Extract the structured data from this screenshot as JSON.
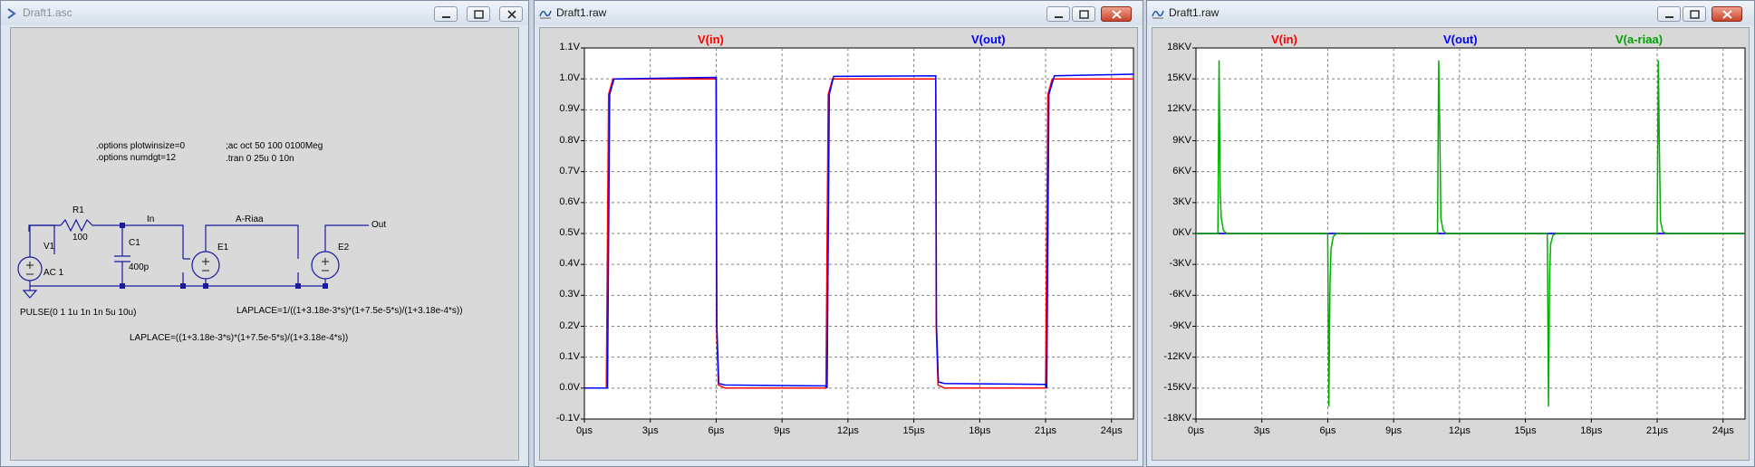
{
  "windows": {
    "schematic": {
      "title": "Draft1.asc"
    },
    "plot1": {
      "title": "Draft1.raw"
    },
    "plot2": {
      "title": "Draft1.raw"
    }
  },
  "schematic": {
    "directives": {
      "opt1": ".options plotwinsize=0",
      "opt2": ".options numdgt=12",
      "ac": ";ac oct 50 100 0100Meg",
      "tran": ".tran 0 25u 0 10n"
    },
    "labels": {
      "r1": "R1",
      "r1_val": "100",
      "c1": "C1",
      "c1_val": "400p",
      "v1": "V1",
      "v1_ac": "AC 1",
      "e1": "E1",
      "e2": "E2",
      "net_in": "In",
      "net_ariaa": "A-Riaa",
      "net_out": "Out",
      "pulse": "PULSE(0 1 1u 1n 1n 5u 10u)",
      "laplace_e2": "LAPLACE=1/((1+3.18e-3*s)*(1+7.5e-5*s)/(1+3.18e-4*s))",
      "laplace_e1": "LAPLACE=((1+3.18e-3*s)*(1+7.5e-5*s)/(1+3.18e-4*s))"
    }
  },
  "plot1": {
    "traces": [
      {
        "name": "V(in)",
        "color": "#ff0000"
      },
      {
        "name": "V(out)",
        "color": "#0000ff"
      }
    ],
    "y_ticks": [
      "1.1V",
      "1.0V",
      "0.9V",
      "0.8V",
      "0.7V",
      "0.6V",
      "0.5V",
      "0.4V",
      "0.3V",
      "0.2V",
      "0.1V",
      "0.0V",
      "-0.1V"
    ],
    "x_ticks": [
      "0µs",
      "3µs",
      "6µs",
      "9µs",
      "12µs",
      "15µs",
      "18µs",
      "21µs",
      "24µs"
    ]
  },
  "plot2": {
    "traces": [
      {
        "name": "V(in)",
        "color": "#ff0000"
      },
      {
        "name": "V(out)",
        "color": "#0000ff"
      },
      {
        "name": "V(a-riaa)",
        "color": "#00b000"
      }
    ],
    "y_ticks": [
      "18KV",
      "15KV",
      "12KV",
      "9KV",
      "6KV",
      "3KV",
      "0KV",
      "-3KV",
      "-6KV",
      "-9KV",
      "-12KV",
      "-15KV",
      "-18KV"
    ],
    "x_ticks": [
      "0µs",
      "3µs",
      "6µs",
      "9µs",
      "12µs",
      "15µs",
      "18µs",
      "21µs",
      "24µs"
    ]
  },
  "chart_data": [
    {
      "type": "line",
      "xlabel": "",
      "ylabel": "",
      "xlim": [
        0,
        25
      ],
      "ylim": [
        -0.1,
        1.1
      ],
      "grid": true,
      "series": [
        {
          "name": "V(in)",
          "x": [
            0,
            1,
            1.1,
            1.3,
            6,
            6.02,
            6.1,
            6.4,
            11,
            11.1,
            11.3,
            16,
            16.02,
            16.1,
            16.4,
            21,
            21.1,
            21.3,
            25
          ],
          "y": [
            0,
            0,
            0.95,
            1.0,
            1.0,
            0.2,
            0.01,
            0.0,
            0.0,
            0.95,
            1.0,
            1.0,
            0.2,
            0.01,
            0.0,
            0.0,
            0.95,
            1.0,
            1.0
          ]
        },
        {
          "name": "V(out)",
          "x": [
            0,
            1.05,
            1.15,
            1.35,
            6,
            6.03,
            6.12,
            6.4,
            11,
            11.05,
            11.15,
            11.35,
            16,
            16.03,
            16.12,
            16.4,
            21,
            21.05,
            21.15,
            21.4,
            25
          ],
          "y": [
            0,
            0,
            0.95,
            1.0,
            1.005,
            0.2,
            0.015,
            0.01,
            0.007,
            0.0,
            0.95,
            1.008,
            1.01,
            0.2,
            0.02,
            0.015,
            0.012,
            0.0,
            0.95,
            1.01,
            1.015
          ]
        }
      ]
    },
    {
      "type": "line",
      "xlabel": "",
      "ylabel": "",
      "xlim": [
        0,
        25
      ],
      "ylim": [
        -18,
        18
      ],
      "grid": true,
      "series": [
        {
          "name": "V(in)",
          "x": [
            0,
            25
          ],
          "y": [
            0,
            0
          ]
        },
        {
          "name": "V(out)",
          "x": [
            0,
            25
          ],
          "y": [
            0,
            0
          ]
        },
        {
          "name": "V(a-riaa)",
          "x": [
            0,
            1,
            1.05,
            1.1,
            1.15,
            1.25,
            1.4,
            6,
            6.05,
            6.1,
            6.15,
            6.25,
            6.4,
            11,
            11.05,
            11.1,
            11.15,
            11.25,
            11.4,
            16,
            16.05,
            16.1,
            16.15,
            16.25,
            16.4,
            21,
            21.05,
            21.1,
            21.15,
            21.25,
            21.4,
            25
          ],
          "y": [
            0,
            0,
            16.8,
            4,
            1.5,
            0.3,
            0,
            0,
            -16.8,
            -5,
            -1.5,
            -0.3,
            0,
            0,
            16.8,
            10,
            1.5,
            0.3,
            0,
            0,
            -16.8,
            -4,
            -1,
            -0.2,
            0,
            0,
            16.8,
            8,
            1.2,
            0.2,
            0,
            0
          ]
        }
      ]
    }
  ]
}
